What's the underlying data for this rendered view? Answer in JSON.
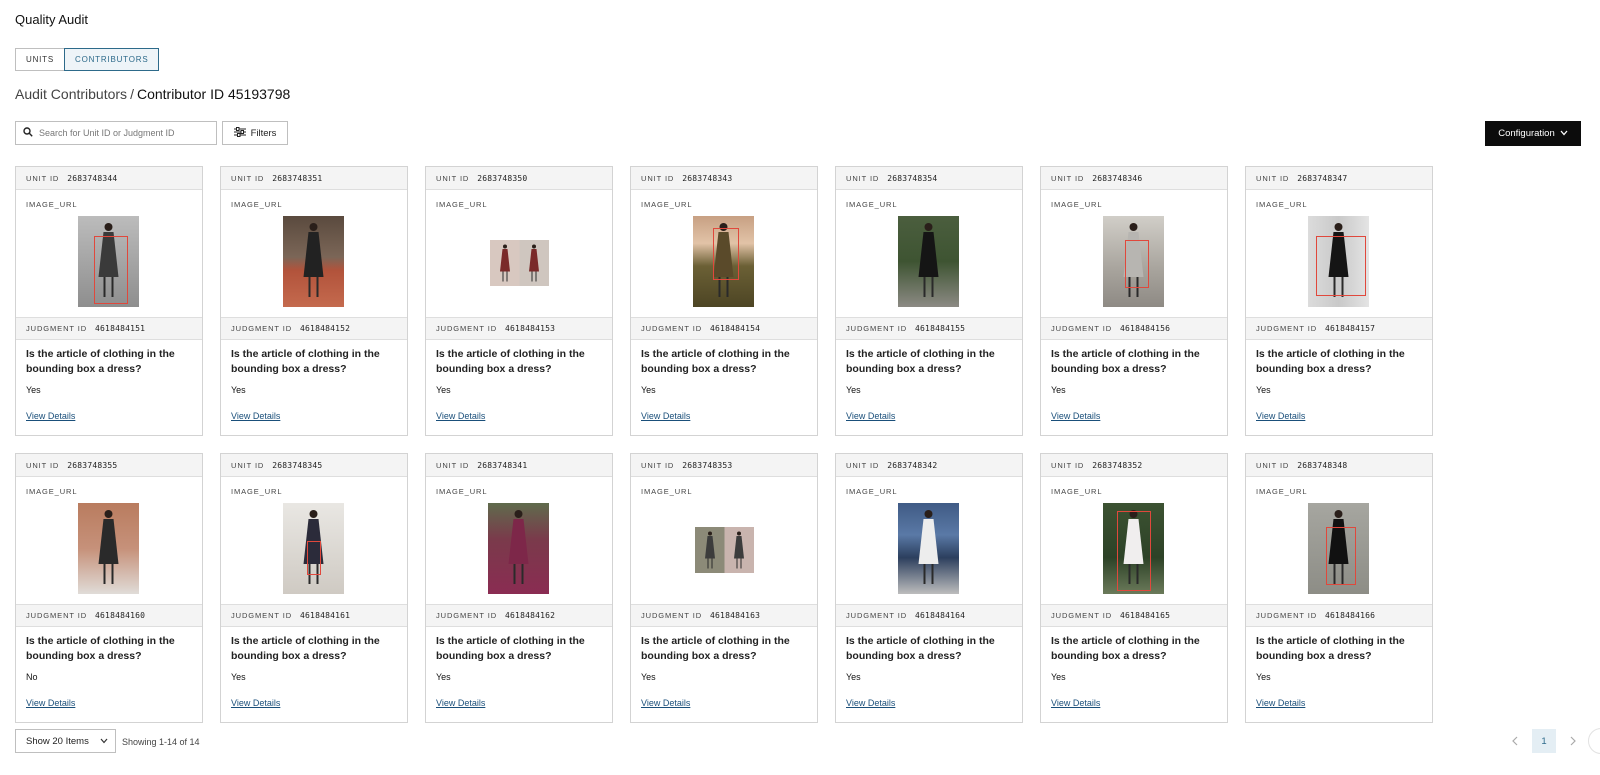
{
  "app": {
    "title": "Quality Audit"
  },
  "tabs": [
    {
      "label": "UNITS"
    },
    {
      "label": "CONTRIBUTORS"
    }
  ],
  "breadcrumb": {
    "parent": "Audit Contributors",
    "separator": "/",
    "current": "Contributor ID 45193798"
  },
  "search": {
    "placeholder": "Search for Unit ID or Judgment ID",
    "icon": "search-icon"
  },
  "filters": {
    "label": "Filters",
    "icon": "sliders-icon"
  },
  "configuration": {
    "label": "Configuration",
    "icon": "chevron-down-icon"
  },
  "labels": {
    "unit_id": "UNIT ID",
    "image_url": "IMAGE_URL",
    "judgment_id": "JUDGMENT ID",
    "view_details": "View Details"
  },
  "cards": [
    {
      "unit_id": "2683748344",
      "judgment_id": "4618484151",
      "question": "Is the article of clothing in the bounding box a dress?",
      "answer": "Yes",
      "thumb": "portrait-dark"
    },
    {
      "unit_id": "2683748351",
      "judgment_id": "4618484152",
      "question": "Is the article of clothing in the bounding box a dress?",
      "answer": "Yes",
      "thumb": "portrait-brick"
    },
    {
      "unit_id": "2683748350",
      "judgment_id": "4618484153",
      "question": "Is the article of clothing in the bounding box a dress?",
      "answer": "Yes",
      "thumb": "collage"
    },
    {
      "unit_id": "2683748343",
      "judgment_id": "4618484154",
      "question": "Is the article of clothing in the bounding box a dress?",
      "answer": "Yes",
      "thumb": "portrait-sunset"
    },
    {
      "unit_id": "2683748354",
      "judgment_id": "4618484155",
      "question": "Is the article of clothing in the bounding box a dress?",
      "answer": "Yes",
      "thumb": "portrait-forest"
    },
    {
      "unit_id": "2683748346",
      "judgment_id": "4618484156",
      "question": "Is the article of clothing in the bounding box a dress?",
      "answer": "Yes",
      "thumb": "portrait-street"
    },
    {
      "unit_id": "2683748347",
      "judgment_id": "4618484157",
      "question": "Is the article of clothing in the bounding box a dress?",
      "answer": "Yes",
      "thumb": "portrait-wall"
    },
    {
      "unit_id": "2683748355",
      "judgment_id": "4618484160",
      "question": "Is the article of clothing in the bounding box a dress?",
      "answer": "No",
      "thumb": "portrait-brick2"
    },
    {
      "unit_id": "2683748345",
      "judgment_id": "4618484161",
      "question": "Is the article of clothing in the bounding box a dress?",
      "answer": "Yes",
      "thumb": "portrait-light"
    },
    {
      "unit_id": "2683748341",
      "judgment_id": "4618484162",
      "question": "Is the article of clothing in the bounding box a dress?",
      "answer": "Yes",
      "thumb": "portrait-plum"
    },
    {
      "unit_id": "2683748353",
      "judgment_id": "4618484163",
      "question": "Is the article of clothing in the bounding box a dress?",
      "answer": "Yes",
      "thumb": "collage2"
    },
    {
      "unit_id": "2683748342",
      "judgment_id": "4618484164",
      "question": "Is the article of clothing in the bounding box a dress?",
      "answer": "Yes",
      "thumb": "portrait-sea"
    },
    {
      "unit_id": "2683748352",
      "judgment_id": "4618484165",
      "question": "Is the article of clothing in the bounding box a dress?",
      "answer": "Yes",
      "thumb": "portrait-garden"
    },
    {
      "unit_id": "2683748348",
      "judgment_id": "4618484166",
      "question": "Is the article of clothing in the bounding box a dress?",
      "answer": "Yes",
      "thumb": "portrait-stone"
    }
  ],
  "footer": {
    "show_items": "Show 20 Items",
    "showing": "Showing 1-14 of 14",
    "current_page": "1"
  },
  "colors": {
    "accent": "#2d6a8a",
    "link": "#1a4f7a",
    "bbox": "#e0483c",
    "primary_button": "#0c0c0c"
  }
}
